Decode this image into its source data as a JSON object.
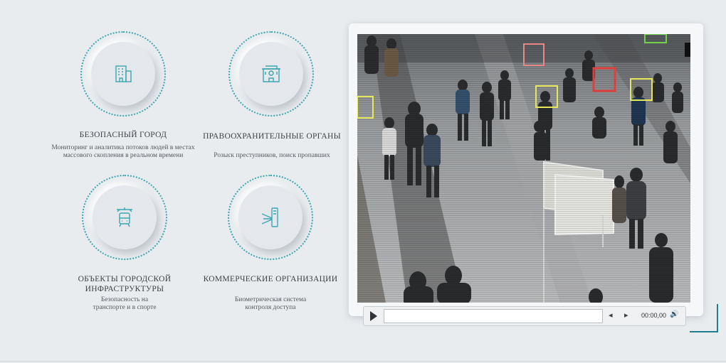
{
  "cards": [
    {
      "title": "БЕЗОПАСНЫЙ ГОРОД",
      "description": "Мониторинг и аналитика потоков людей в местах массового скопления в реальном времени",
      "icon": "city-building-icon"
    },
    {
      "title": "ПРАВООХРАНИТЕЛЬНЫЕ ОРГАНЫ",
      "description": "Розыск преступников, поиск пропавших",
      "icon": "police-station-icon"
    },
    {
      "title": "ОБЪЕКТЫ ГОРОДСКОЙ ИНФРАСТРУКТУРЫ",
      "description": "Безопасность на транспорте и в спорте",
      "icon": "train-icon"
    },
    {
      "title": "КОММЕРЧЕСКИЕ ОРГАНИЗАЦИИ",
      "description": "Биометрическая система контроля доступа",
      "icon": "turnstile-icon"
    }
  ],
  "video": {
    "time": "00:00,00"
  },
  "colors": {
    "accent": "#3aa6b0",
    "corner": "#1f7f8f",
    "box_red": "#e0403c",
    "box_yellow": "#e6e65a",
    "box_green": "#6fd24a",
    "box_pink": "#e88a8a"
  }
}
